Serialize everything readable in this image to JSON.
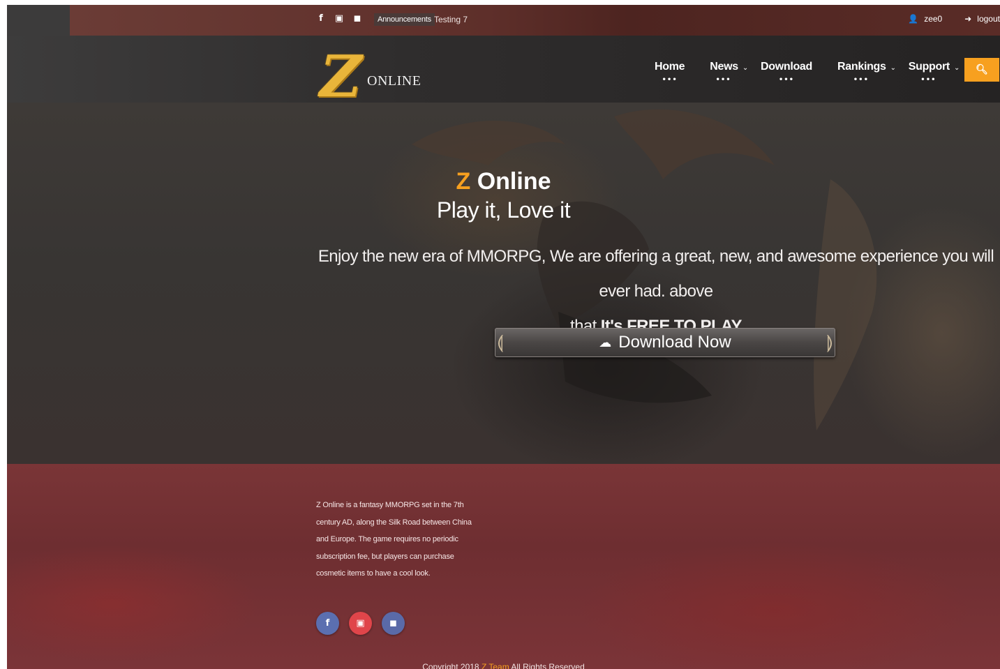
{
  "topbar": {
    "social_icons": [
      "facebook-icon",
      "youtube-icon",
      "discord-icon"
    ],
    "announcement_label": "Announcements",
    "announcement_text": "Testing 7",
    "user_name": "zee0",
    "logout_label": "logout"
  },
  "header": {
    "logo_text": "ONLINE",
    "nav": {
      "home": "Home",
      "news": "News",
      "download": "Download",
      "rankings": "Rankings",
      "support": "Support"
    },
    "accent_color": "#f7a01f"
  },
  "hero": {
    "title_accent": "Z",
    "title_main": "Online",
    "subtitle": "Play it, Love it",
    "description_line1": "Enjoy the new era of MMORPG, We are offering a great, new, and awesome experience you will ever had. above",
    "description_prefix": "that",
    "description_bold": "It's FREE TO PLAY",
    "download_button": "Download Now"
  },
  "footer": {
    "about": "Z Online is a fantasy MMORPG set in the 7th century AD, along the Silk Road between China and Europe. The game requires no periodic subscription fee, but players can purchase cosmetic items to have a cool look.",
    "social_icons": [
      "facebook-icon",
      "youtube-icon",
      "discord-icon"
    ],
    "copyright_prefix": "Copyright 2018",
    "copyright_team": "Z Team",
    "copyright_suffix": "All Rights Reserved"
  }
}
